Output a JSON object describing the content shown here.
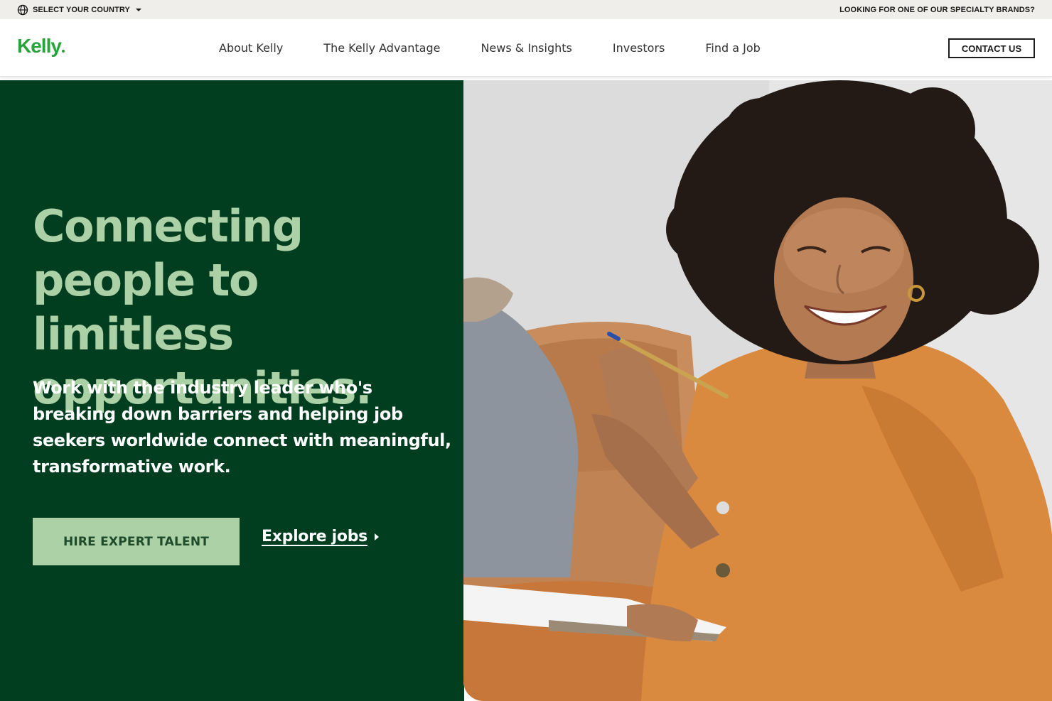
{
  "utility_bar": {
    "country_label": "SELECT YOUR COUNTRY",
    "specialty_label": "LOOKING FOR ONE OF OUR SPECIALTY BRANDS?"
  },
  "header": {
    "logo": "Kelly",
    "nav": [
      {
        "label": "About Kelly"
      },
      {
        "label": "The Kelly Advantage"
      },
      {
        "label": "News & Insights"
      },
      {
        "label": "Investors"
      },
      {
        "label": "Find a Job"
      }
    ],
    "contact_label": "CONTACT US"
  },
  "hero": {
    "title": "Connecting people to limitless opportunities.",
    "subtitle": "Work with the industry leader who's breaking down barriers and helping job seekers worldwide connect with meaningful, transformative work.",
    "primary_cta": "HIRE EXPERT TALENT",
    "secondary_cta": "Explore jobs",
    "image_icon": "smiling-woman-photo"
  },
  "colors": {
    "brand_green": "#27a43b",
    "hero_bg": "#003e1f",
    "hero_title": "#acd1a7",
    "cta_bg": "#acd1a7"
  }
}
